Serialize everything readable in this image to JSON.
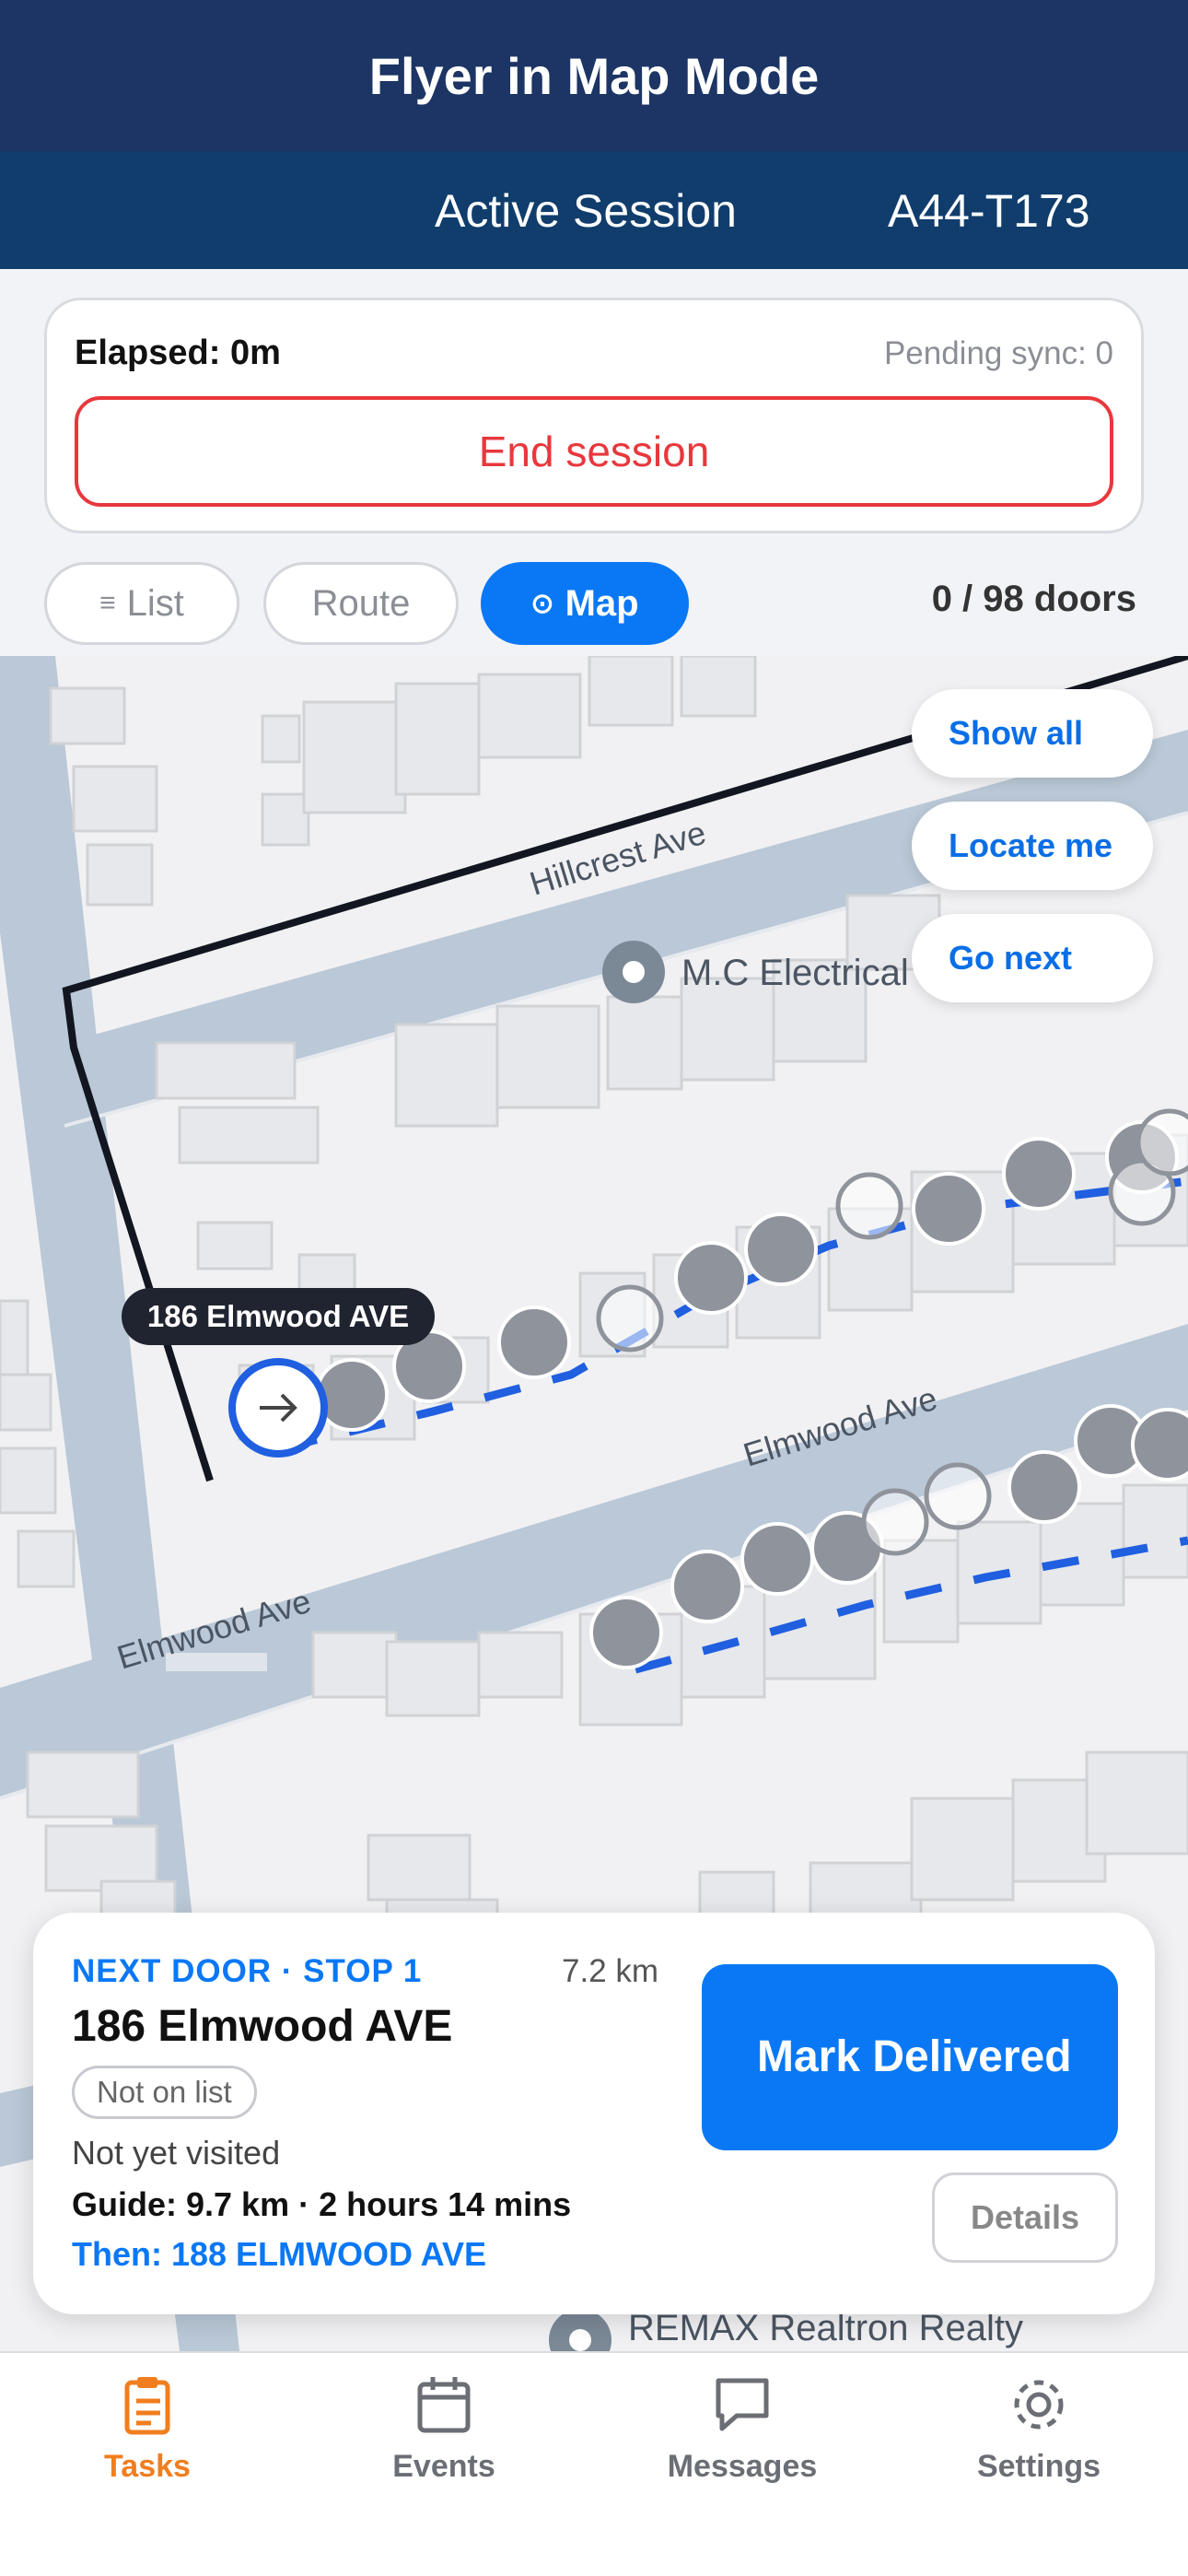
{
  "header": {
    "title": "Flyer in Map Mode"
  },
  "session": {
    "label": "Active Session",
    "code": "A44-T173"
  },
  "session_card": {
    "elapsed": "Elapsed: 0m",
    "pending": "Pending sync: 0",
    "end_label": "End session"
  },
  "view_tabs": {
    "list": "List",
    "route": "Route",
    "map": "Map",
    "selected": "map"
  },
  "progress": {
    "doors_text": "0 / 98 doors",
    "visited": 0,
    "total": 98
  },
  "map": {
    "streets": {
      "hillcrest": "Hillcrest Ave",
      "elmwood_upper": "Elmwood Ave",
      "elmwood_lower": "Elmwood Ave"
    },
    "pois": {
      "electrical": "M.C Electrical I",
      "remax": "REMAX Realtron Realty"
    },
    "callout": "186 Elmwood AVE",
    "controls": {
      "show_all": "Show all",
      "locate_me": "Locate me",
      "go_next": "Go next"
    }
  },
  "next_door": {
    "heading": "NEXT DOOR · STOP 1",
    "distance": "7.2 km",
    "address": "186 Elmwood AVE",
    "badge": "Not on list",
    "status": "Not yet visited",
    "guide": "Guide: 9.7 km · 2 hours 14 mins",
    "then": "Then: 188 ELMWOOD AVE",
    "mark_label": "Mark Delivered",
    "details_label": "Details"
  },
  "tabbar": {
    "items": [
      {
        "label": "Tasks",
        "icon": "clipboard-icon",
        "active": true
      },
      {
        "label": "Events",
        "icon": "calendar-icon",
        "active": false
      },
      {
        "label": "Messages",
        "icon": "message-icon",
        "active": false
      },
      {
        "label": "Settings",
        "icon": "gear-icon",
        "active": false
      }
    ]
  },
  "colors": {
    "header_bg": "#1c3564",
    "session_bg": "#103d6c",
    "accent": "#0a78f5",
    "danger": "#e8383d",
    "tab_active": "#f07e1f",
    "route": "#1f5fe0"
  }
}
